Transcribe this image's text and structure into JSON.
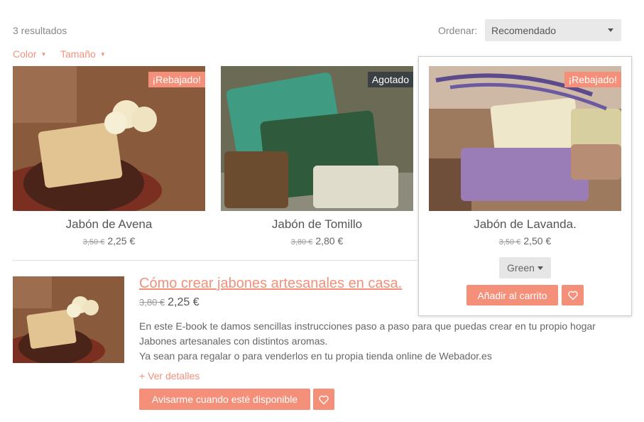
{
  "results": {
    "count_text": "3 resultados"
  },
  "sort": {
    "label": "Ordenar:",
    "value": "Recomendado"
  },
  "filters": [
    {
      "label": "Color"
    },
    {
      "label": "Tamaño"
    }
  ],
  "products": [
    {
      "name": "Jabón de Avena",
      "old_price": "3,50 €",
      "price": "2,25 €",
      "badge": "¡Rebajado!"
    },
    {
      "name": "Jabón de Tomillo",
      "old_price": "3,80 €",
      "price": "2,80 €",
      "badge": "Agotado"
    },
    {
      "name": "Jabón de Lavanda.",
      "old_price": "3,50 €",
      "price": "2,50 €",
      "badge": "¡Rebajado!",
      "variant": "Green",
      "add_to_cart": "Añadir al carrito"
    }
  ],
  "featured": {
    "title": "Cómo crear jabones artesanales en casa.",
    "old_price": "3,80 €",
    "price": "2,25 €",
    "description_line1": "En este E-book te damos sencillas instrucciones paso a paso para que puedas crear en tu propio hogar",
    "description_line2": "Jabones artesanales con distintos aromas.",
    "description_line3": "Ya sean para regalar o para venderlos en tu propia tienda online de Webador.es",
    "details_link": "+ Ver detalles",
    "notify_button": "Avisarme cuando esté disponible"
  },
  "colors": {
    "accent": "#f4907a",
    "badge_dark": "#3b4045"
  }
}
